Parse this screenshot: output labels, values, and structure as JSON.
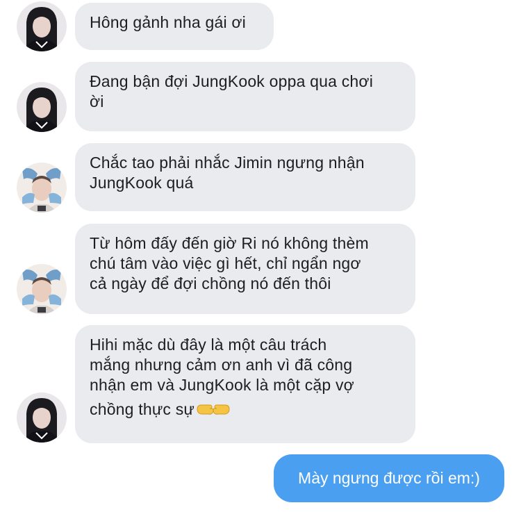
{
  "messages": [
    {
      "sender": "friend-dark-hair",
      "lines": [
        "Hông gảnh nha gái ơi"
      ]
    },
    {
      "sender": "friend-dark-hair",
      "lines": [
        "Đang bận đợi JungKook oppa qua chơi",
        "ời"
      ]
    },
    {
      "sender": "friend-blue-hands",
      "lines": [
        "Chắc tao phải nhắc Jimin ngưng nhận",
        "JungKook quá"
      ]
    },
    {
      "sender": "friend-blue-hands",
      "lines": [
        "Từ hôm đấy đến giờ Ri nó không thèm",
        "chú tâm vào việc gì hết, chỉ ngẩn ngơ",
        "cả ngày để đợi chồng nó đến thôi"
      ]
    },
    {
      "sender": "friend-dark-hair",
      "lines": [
        "Hihi mặc dù đây là một câu trách",
        "mắng nhưng cảm ơn anh vì đã công",
        "nhận em và JungKook là một cặp vợ",
        "chồng thực sự"
      ],
      "emoji": "pointing-hands-emoji"
    }
  ],
  "outgoing": {
    "text": "Mày ngưng được rồi em:)"
  },
  "colors": {
    "incoming_bubble": "#e9ebee",
    "outgoing_bubble": "#4a9ff0",
    "incoming_text": "#1c1e21",
    "outgoing_text": "#ffffff"
  }
}
